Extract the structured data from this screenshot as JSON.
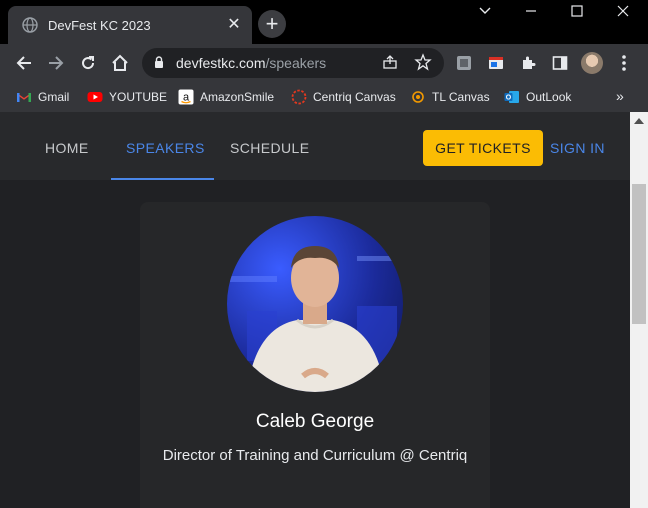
{
  "browser": {
    "tab_title": "DevFest KC 2023",
    "new_tab_symbol": "+",
    "close_symbol": "✕",
    "url_domain": "devfestkc.com",
    "url_path": "/speakers"
  },
  "bookmarks": {
    "items": [
      {
        "label": "Gmail",
        "icon": "gmail-icon"
      },
      {
        "label": "YOUTUBE",
        "icon": "youtube-icon"
      },
      {
        "label": "AmazonSmile",
        "icon": "amazon-icon"
      },
      {
        "label": "Centriq Canvas",
        "icon": "canvas-icon"
      },
      {
        "label": "TL Canvas",
        "icon": "tl-canvas-icon"
      },
      {
        "label": "OutLook",
        "icon": "outlook-icon"
      }
    ],
    "more_symbol": "»"
  },
  "site_nav": {
    "home": "HOME",
    "speakers": "SPEAKERS",
    "schedule": "SCHEDULE",
    "get_tickets": "GET TICKETS",
    "sign_in": "SIGN IN"
  },
  "speaker": {
    "name": "Caleb George",
    "title": "Director of Training and Curriculum @ Centriq"
  },
  "colors": {
    "accent": "#4a86e8",
    "tickets_button": "#fbbc04",
    "page_background": "#202124"
  }
}
